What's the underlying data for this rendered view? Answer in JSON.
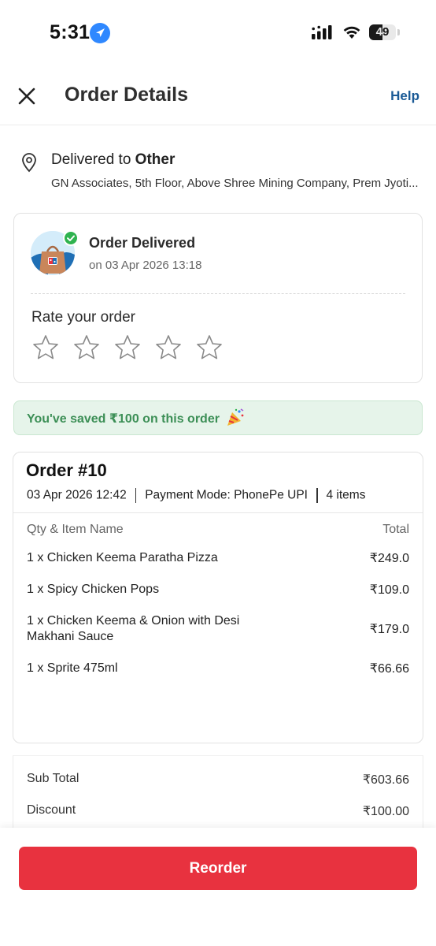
{
  "status_bar": {
    "time": "5:31",
    "battery": "49",
    "battery_level": 0.49
  },
  "header": {
    "title": "Order Details",
    "help": "Help"
  },
  "address": {
    "label_prefix": "Delivered to ",
    "label_type": "Other",
    "full": "GN Associates, 5th Floor, Above Shree Mining Company, Prem Jyoti..."
  },
  "delivery": {
    "status": "Order Delivered",
    "date": "on 03 Apr 2026 13:18",
    "rate_label": "Rate your order",
    "rating": 0,
    "max_rating": 5
  },
  "savings": {
    "text": "You've saved ₹100 on this order"
  },
  "order": {
    "title": "Order #10",
    "date": "03 Apr 2026 12:42",
    "payment": "Payment Mode: PhonePe UPI",
    "items_count": "4 items",
    "col_item": "Qty & Item Name",
    "col_total": "Total",
    "items": [
      {
        "name": "1 x Chicken Keema Paratha Pizza",
        "total": "₹249.0"
      },
      {
        "name": "1 x Spicy Chicken Pops",
        "total": "₹109.0"
      },
      {
        "name": "1 x Chicken Keema & Onion with Desi Makhani Sauce",
        "total": "₹179.0"
      },
      {
        "name": "1 x Sprite 475ml",
        "total": "₹66.66"
      }
    ]
  },
  "summary": {
    "rows": [
      {
        "label": "Sub Total",
        "value": "₹603.66"
      },
      {
        "label": "Discount",
        "value": "₹100.00"
      }
    ]
  },
  "actions": {
    "reorder": "Reorder"
  },
  "colors": {
    "accent": "#e8323f",
    "help_link": "#1a5a96",
    "savings_bg": "#e6f4ea",
    "savings_text": "#3c8f56",
    "success": "#2fb350"
  }
}
